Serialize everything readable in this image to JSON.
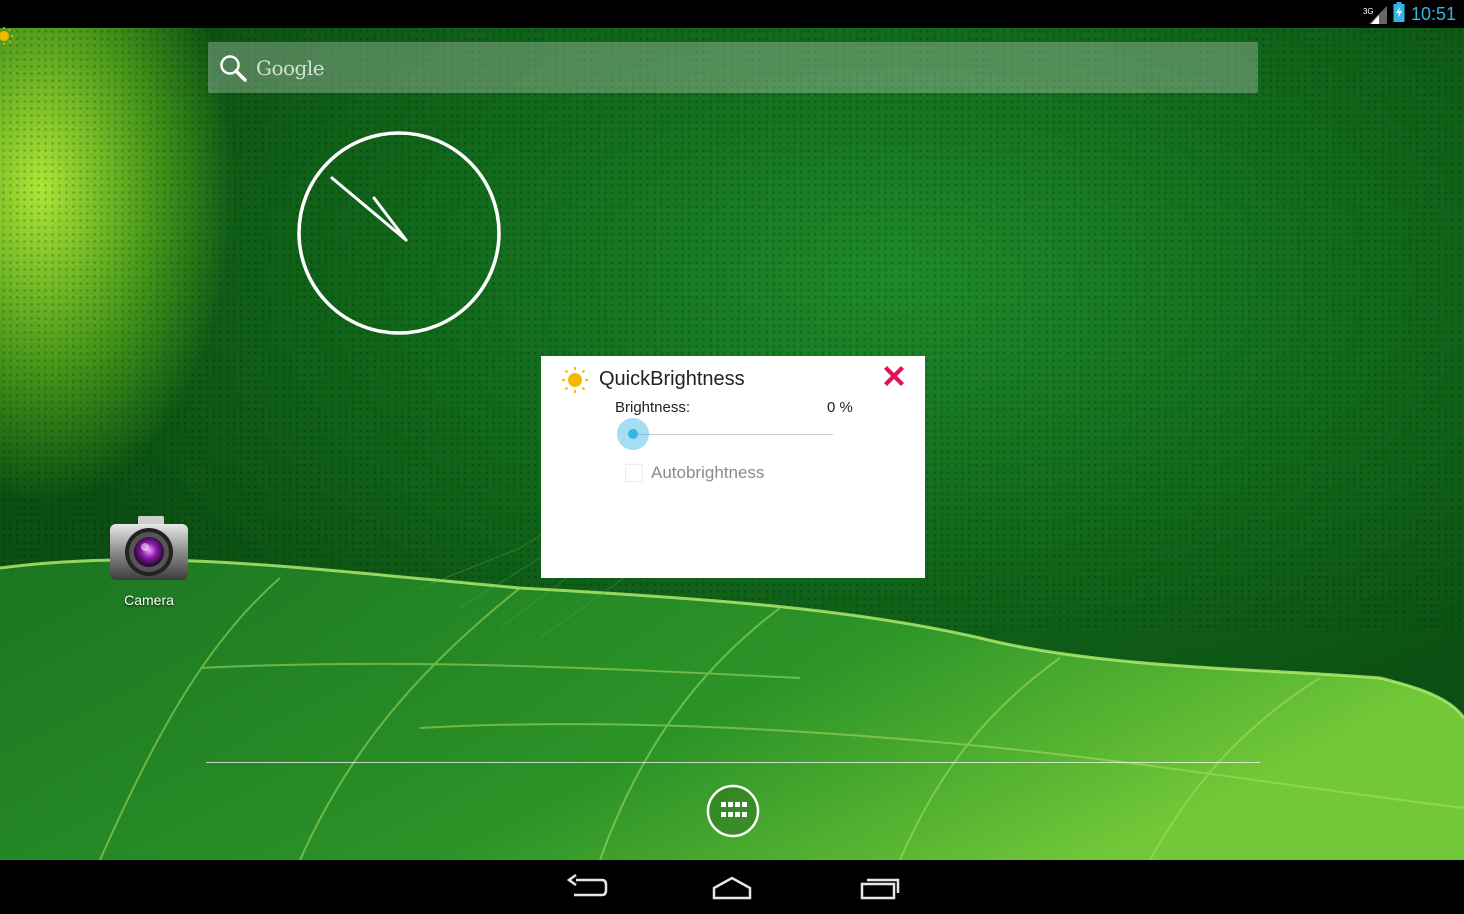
{
  "status_bar": {
    "time": "10:51",
    "signal_label": "3G"
  },
  "search": {
    "placeholder": "Google"
  },
  "apps": {
    "camera_label": "Camera"
  },
  "dialog": {
    "title": "QuickBrightness",
    "brightness_label": "Brightness:",
    "brightness_value": "0 %",
    "brightness_level": 0,
    "autobrightness_label": "Autobrightness",
    "autobrightness_checked": false
  },
  "colors": {
    "accent": "#33b5e5",
    "close": "#e0105a",
    "sun": "#f5b800"
  },
  "icons": {
    "search": "search-icon",
    "close": "close-icon",
    "sun": "sun-icon",
    "camera": "camera-icon",
    "all_apps": "all-apps-icon",
    "back": "back-icon",
    "home": "home-icon",
    "recents": "recents-icon",
    "signal": "signal-icon",
    "battery": "battery-icon"
  }
}
